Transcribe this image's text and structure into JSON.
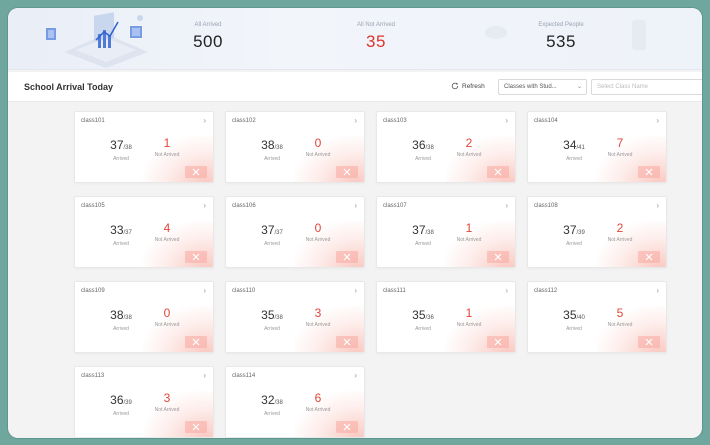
{
  "stats": {
    "arrived": {
      "label": "All Arrived",
      "value": "500"
    },
    "not_arrived": {
      "label": "All Not Arrived",
      "value": "35"
    },
    "expected": {
      "label": "Expected People",
      "value": "535"
    }
  },
  "toolbar": {
    "title": "School Arrival Today",
    "refresh_label": "Refresh",
    "filter_select": "Classes with Stud...",
    "class_name_placeholder": "Select Class Name"
  },
  "card_labels": {
    "arrived": "Arrived",
    "not_arrived": "Not Arrived"
  },
  "colors": {
    "accent_red": "#e2453a",
    "frame_bg": "#6fa79e"
  },
  "classes": [
    {
      "name": "class101",
      "arrived": "37",
      "total": "38",
      "not_arrived": "1"
    },
    {
      "name": "class102",
      "arrived": "38",
      "total": "38",
      "not_arrived": "0"
    },
    {
      "name": "class103",
      "arrived": "36",
      "total": "38",
      "not_arrived": "2"
    },
    {
      "name": "class104",
      "arrived": "34",
      "total": "41",
      "not_arrived": "7"
    },
    {
      "name": "class105",
      "arrived": "33",
      "total": "37",
      "not_arrived": "4"
    },
    {
      "name": "class106",
      "arrived": "37",
      "total": "37",
      "not_arrived": "0"
    },
    {
      "name": "class107",
      "arrived": "37",
      "total": "38",
      "not_arrived": "1"
    },
    {
      "name": "class108",
      "arrived": "37",
      "total": "39",
      "not_arrived": "2"
    },
    {
      "name": "class109",
      "arrived": "38",
      "total": "38",
      "not_arrived": "0"
    },
    {
      "name": "class110",
      "arrived": "35",
      "total": "38",
      "not_arrived": "3"
    },
    {
      "name": "class111",
      "arrived": "35",
      "total": "36",
      "not_arrived": "1"
    },
    {
      "name": "class112",
      "arrived": "35",
      "total": "40",
      "not_arrived": "5"
    },
    {
      "name": "class113",
      "arrived": "36",
      "total": "39",
      "not_arrived": "3"
    },
    {
      "name": "class114",
      "arrived": "32",
      "total": "38",
      "not_arrived": "6"
    }
  ]
}
